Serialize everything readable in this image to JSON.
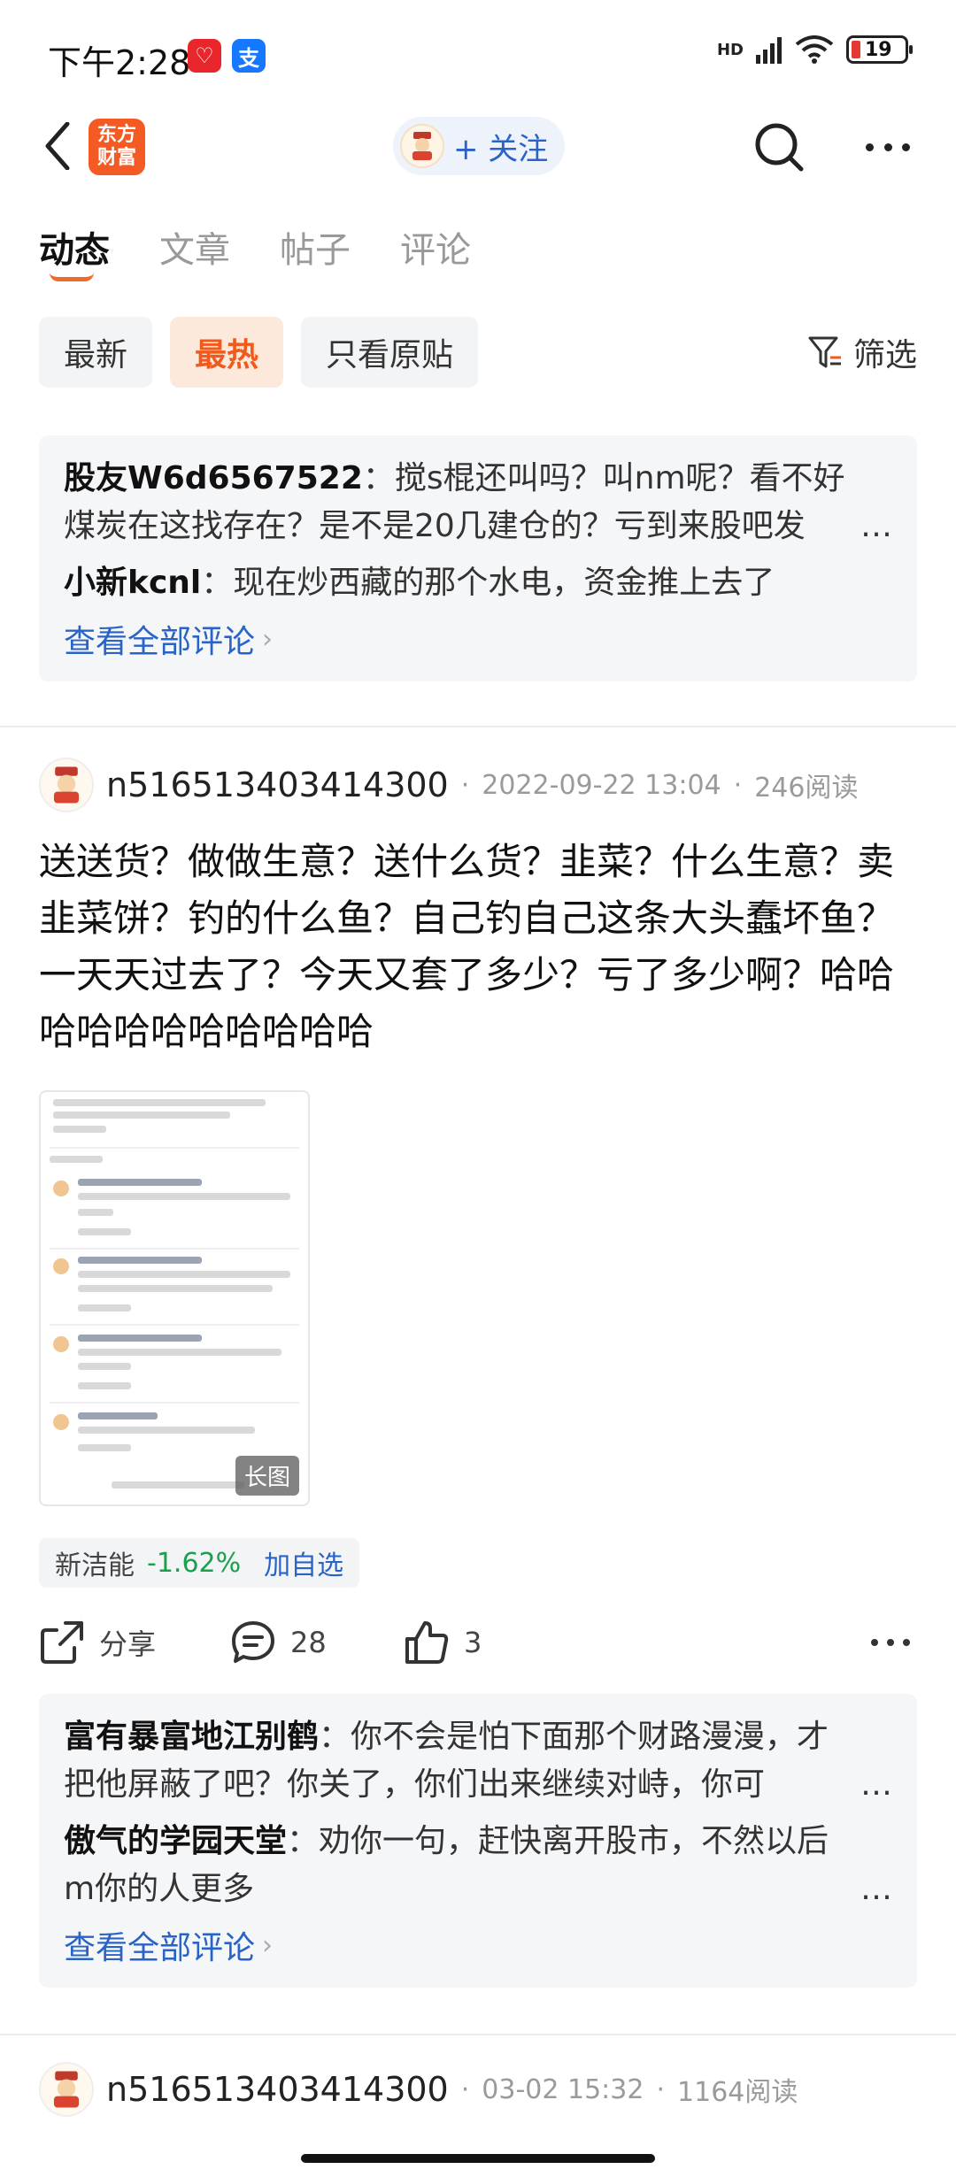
{
  "status_bar": {
    "time": "下午2:28",
    "badge1": "♡",
    "badge2": "支",
    "network": "HD",
    "battery": "19"
  },
  "nav": {
    "logo_text": "东方财富",
    "follow_label": "+ 关注"
  },
  "tabs": [
    {
      "label": "动态"
    },
    {
      "label": "文章"
    },
    {
      "label": "帖子"
    },
    {
      "label": "评论"
    }
  ],
  "filters": {
    "chips": [
      "最新",
      "最热",
      "只看原贴"
    ],
    "filter_label": "筛选"
  },
  "top_comments": {
    "items": [
      {
        "author": "股友W6d6567522",
        "text": "搅s棍还叫吗？叫nm呢？看不好煤炭在这找存在？是不是20几建仓的？亏到来股吧发"
      },
      {
        "author": "小新kcnl",
        "text": "现在炒西藏的那个水电，资金推上去了"
      }
    ],
    "view_all": "查看全部评论"
  },
  "post1": {
    "username": "n516513403414300",
    "datetime": "2022-09-22 13:04",
    "reads": "246阅读",
    "text": "送送货？做做生意？送什么货？韭菜？什么生意？卖韭菜饼？钓的什么鱼？自己钓自己这条大头蠢坏鱼？一天天过去了？今天又套了多少？亏了多少啊？哈哈哈哈哈哈哈哈哈哈哈",
    "image_tag": "长图",
    "stock": {
      "name": "新洁能",
      "change": "-1.62%",
      "add": "加自选"
    },
    "actions": {
      "share": "分享",
      "comments": "28",
      "likes": "3"
    },
    "comments": [
      {
        "author": "富有暴富地江别鹤",
        "text": "你不会是怕下面那个财路漫漫，才把他屏蔽了吧？你关了，你们出来继续对峙，你可"
      },
      {
        "author": "傲气的学园天堂",
        "text": "劝你一句，赶快离开股市，不然以后m你的人更多"
      }
    ],
    "view_all": "查看全部评论"
  },
  "post2": {
    "username": "n516513403414300",
    "datetime": "03-02 15:32",
    "reads": "1164阅读"
  },
  "colors": {
    "accent": "#f05a1c",
    "link": "#2a63c6",
    "down": "#1a9f4b"
  }
}
